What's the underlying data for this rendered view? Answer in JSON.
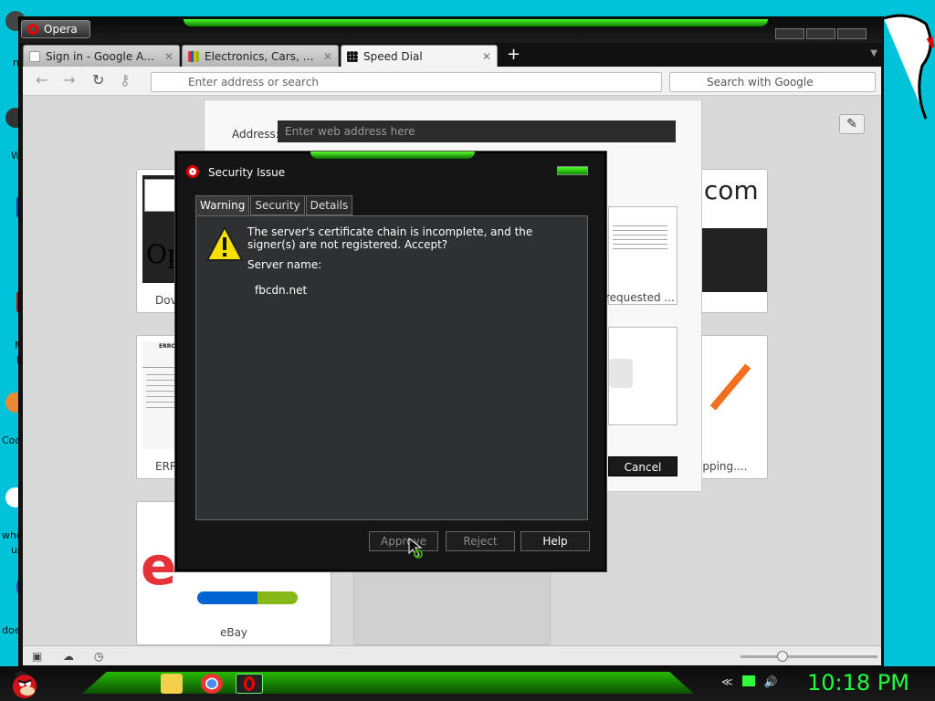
{
  "browser": {
    "menu_button": "Opera",
    "tabs": [
      {
        "title": "Sign in - Google Accou...",
        "active": false
      },
      {
        "title": "Electronics, Cars, Fashi...",
        "active": false
      },
      {
        "title": "Speed Dial",
        "active": true
      }
    ],
    "new_tab": "+",
    "address_placeholder": "Enter address or search",
    "search_placeholder": "Search with Google"
  },
  "speed_dial": {
    "address_label": "Address:",
    "address_placeholder": "Enter web address here",
    "cancel_label": "Cancel",
    "tiles": [
      {
        "label": "Dov",
        "thumb": "Op"
      },
      {
        "label": "ERR",
        "thumb": "ERRO"
      },
      {
        "label": "eBay",
        "thumb": "e"
      },
      {
        "label": "requested ...",
        "thumb": ""
      },
      {
        "label": "",
        "thumb": ".com"
      },
      {
        "label": "opping....",
        "thumb": ""
      }
    ]
  },
  "dialog": {
    "title": "Security Issue",
    "tabs": [
      "Warning",
      "Security",
      "Details"
    ],
    "message": "The server's certificate chain is incomplete, and the signer(s) are not registered. Accept?",
    "server_label": "Server name:",
    "server_value": "fbcdn.net",
    "buttons": {
      "approve": "Approve",
      "reject": "Reject",
      "help": "Help"
    }
  },
  "desktop": {
    "labels": [
      "m",
      "W",
      "M",
      "F",
      "Coo",
      "who",
      "us",
      "doe"
    ]
  },
  "taskbar": {
    "clock": "10:18 PM"
  },
  "colors": {
    "desktop": "#00c2d9",
    "accent_green": "#2ad800",
    "clock": "#20ff40"
  }
}
